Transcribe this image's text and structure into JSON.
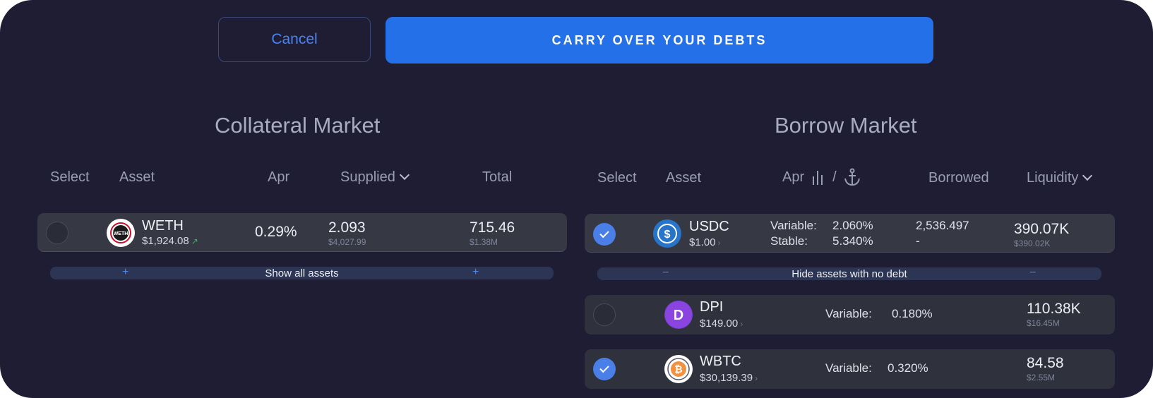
{
  "actions": {
    "cancel_label": "Cancel",
    "carry_label": "CARRY OVER YOUR DEBTS"
  },
  "collateral": {
    "title": "Collateral Market",
    "headers": {
      "select": "Select",
      "asset": "Asset",
      "apr": "Apr",
      "supplied": "Supplied",
      "total": "Total"
    },
    "rows": [
      {
        "symbol": "WETH",
        "price": "$1,924.08",
        "apr": "0.29%",
        "supplied": "2.093",
        "supplied_usd": "$4,027.99",
        "total": "715.46",
        "total_usd": "$1.38M",
        "selected": false
      }
    ],
    "show_all_label": "Show all assets",
    "plus": "+"
  },
  "borrow": {
    "title": "Borrow Market",
    "headers": {
      "select": "Select",
      "asset": "Asset",
      "apr": "Apr",
      "apr_sep": "/",
      "borrowed": "Borrowed",
      "liquidity": "Liquidity"
    },
    "rows": [
      {
        "symbol": "USDC",
        "price": "$1.00",
        "variable_label": "Variable:",
        "variable": "2.060%",
        "stable_label": "Stable:",
        "stable": "5.340%",
        "borrowed": "2,536.497",
        "borrowed_stable": "-",
        "liquidity": "390.07K",
        "liquidity_usd": "$390.02K",
        "selected": true
      },
      {
        "symbol": "DPI",
        "price": "$149.00",
        "variable_label": "Variable:",
        "variable": "0.180%",
        "liquidity": "110.38K",
        "liquidity_usd": "$16.45M",
        "selected": false
      },
      {
        "symbol": "WBTC",
        "price": "$30,139.39",
        "variable_label": "Variable:",
        "variable": "0.320%",
        "liquidity": "84.58",
        "liquidity_usd": "$2.55M",
        "selected": true
      }
    ],
    "hide_label": "Hide assets with no debt",
    "minus": "−"
  },
  "icons": {
    "arrow": "›",
    "arrow_up": "↗"
  },
  "colors": {
    "background": "#1e1d33",
    "accent": "#2470e8",
    "check": "#4a7fe8"
  }
}
